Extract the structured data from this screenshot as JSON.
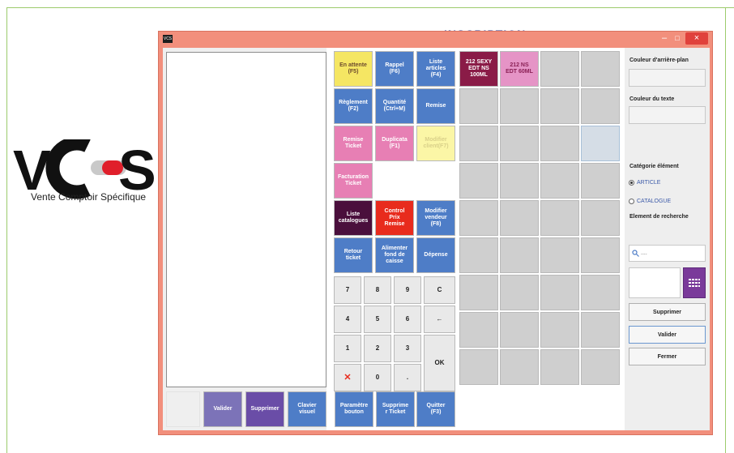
{
  "background": {
    "title_partial": "INSCRIPTION",
    "logo_letters": "VCS",
    "logo_tagline": "Vente Comptoir Spécifique"
  },
  "window": {
    "icon_text": "VCS",
    "controls": {
      "minimize": "–",
      "maximize": "□",
      "close": "×"
    }
  },
  "function_buttons": [
    {
      "id": "en-attente",
      "label": "En attente\n(F5)",
      "color": "#f5e663"
    },
    {
      "id": "rappel",
      "label": "Rappel\n(F6)",
      "color": "#4e7dc7"
    },
    {
      "id": "liste-articles",
      "label": "Liste\narticles\n(F4)",
      "color": "#4e7dc7"
    },
    {
      "id": "reglement",
      "label": "Règlement\n(F2)",
      "color": "#4e7dc7"
    },
    {
      "id": "quantite",
      "label": "Quantité\n(Ctrl+M)",
      "color": "#4e7dc7"
    },
    {
      "id": "remise",
      "label": "Remise",
      "color": "#4e7dc7"
    },
    {
      "id": "remise-ticket",
      "label": "Remise\nTicket",
      "color": "#e77fb4"
    },
    {
      "id": "duplicata",
      "label": "Duplicata\n(F1)",
      "color": "#e77fb4"
    },
    {
      "id": "modifier-client",
      "label": "Modifier\nclient(F7)",
      "color": "#fbf6a6"
    },
    {
      "id": "facturation-ticket",
      "label": "Facturation\nTicket",
      "color": "#e77fb4"
    },
    {
      "id": "liste-catalogues",
      "label": "Liste\ncatalogues",
      "color": "#4a0f3c"
    },
    {
      "id": "control-prix-remise",
      "label": "Control\nPrix\nRemise",
      "color": "#e82b1d"
    },
    {
      "id": "modifier-vendeur",
      "label": "Modifier\nvendeur\n(F8)",
      "color": "#4e7dc7"
    },
    {
      "id": "retour-ticket",
      "label": "Retour\nticket",
      "color": "#4e7dc7"
    },
    {
      "id": "alimenter-fond",
      "label": "Alimenter\nfond de\ncaisse",
      "color": "#4e7dc7"
    },
    {
      "id": "depense",
      "label": "Dépense",
      "color": "#4e7dc7"
    }
  ],
  "keypad": [
    "7",
    "8",
    "9",
    "C",
    "4",
    "5",
    "6",
    "←",
    "1",
    "2",
    "3",
    "OK",
    "✕",
    "0",
    "."
  ],
  "articles": [
    {
      "label": "212 SEXY\nEDT NS\n100ML",
      "color": "#8a1b47"
    },
    {
      "label": "212 NS\nEDT 60ML",
      "color": "#e594c6"
    }
  ],
  "bottom_buttons": [
    {
      "id": "valider",
      "label": "Valider"
    },
    {
      "id": "supprimer",
      "label": "Supprimer"
    },
    {
      "id": "clavier-visuel",
      "label": "Clavier\nvisuel"
    },
    {
      "id": "parametre-bouton",
      "label": "Paramètre\nbouton"
    },
    {
      "id": "supprimer-ticket",
      "label": "Supprime\nr Ticket"
    },
    {
      "id": "quitter",
      "label": "Quitter\n(F3)"
    }
  ],
  "right_panel": {
    "bg_color_label": "Couleur d'arrière-plan",
    "text_color_label": "Couleur du texte",
    "category_label": "Catégorie élément",
    "radio_article": "ARTICLE",
    "radio_catalogue": "CATALOGUE",
    "radio_selected": "ARTICLE",
    "search_label": "Element de recherche",
    "search_placeholder": "....",
    "btn_supprimer": "Supprimer",
    "btn_valider": "Valider",
    "btn_fermer": "Fermer"
  }
}
